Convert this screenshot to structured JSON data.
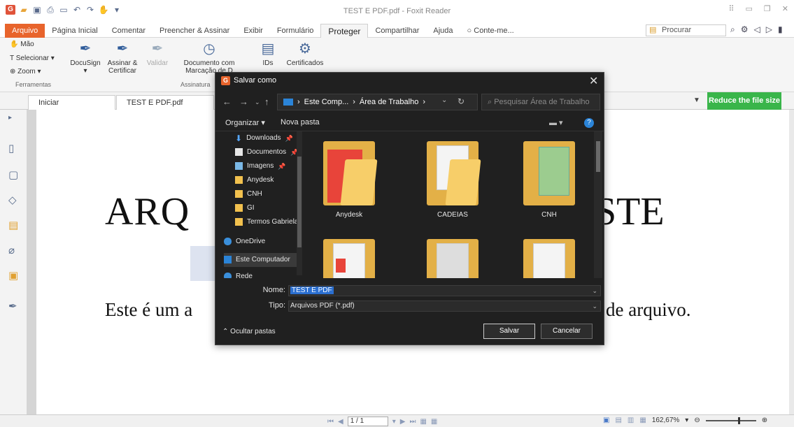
{
  "window": {
    "title": "TEST E PDF.pdf - Foxit Reader",
    "logo_letter": "G"
  },
  "menu": {
    "tabs": [
      "Arquivo",
      "Página Inicial",
      "Comentar",
      "Preencher & Assinar",
      "Exibir",
      "Formulário",
      "Proteger",
      "Compartilhar",
      "Ajuda",
      "Conte-me..."
    ],
    "active_tab": "Proteger",
    "search_placeholder": "Procurar"
  },
  "ribbon": {
    "tools": {
      "hand": "Mão",
      "select": "Selecionar",
      "zoom": "Zoom",
      "group_label": "Ferramentas"
    },
    "docusign": "DocuSign",
    "sign_certify_1": "Assinar &",
    "sign_certify_2": "Certificar",
    "validate": "Validar",
    "doc_with_1": "Documento com",
    "doc_with_2": "Marcação de D",
    "sign_group": "Assinatura",
    "ids": "IDs",
    "certificates": "Certificados"
  },
  "doctabs": {
    "start": "Iniciar",
    "file": "TEST E PDF.pdf",
    "reduce": "Reduce the file size"
  },
  "document": {
    "title_left": "ARQ",
    "title_right": "STE",
    "body_left": "Este é um a",
    "body_right": "de arquivo."
  },
  "statusbar": {
    "page": "1 / 1",
    "zoom": "162,67%"
  },
  "dialog": {
    "title": "Salvar como",
    "breadcrumb_1": "Este Comp...",
    "breadcrumb_2": "Área de Trabalho",
    "search_placeholder": "Pesquisar Área de Trabalho",
    "organize": "Organizar",
    "new_folder": "Nova pasta",
    "nav_items": [
      {
        "label": "Downloads",
        "icon": "download-icon",
        "pinned": true
      },
      {
        "label": "Documentos",
        "icon": "documents-icon",
        "pinned": true
      },
      {
        "label": "Imagens",
        "icon": "pictures-icon",
        "pinned": true
      },
      {
        "label": "Anydesk",
        "icon": "folder-icon",
        "pinned": false
      },
      {
        "label": "CNH",
        "icon": "folder-icon",
        "pinned": false
      },
      {
        "label": "GI",
        "icon": "folder-icon",
        "pinned": false
      },
      {
        "label": "Termos Gabriela",
        "icon": "folder-icon",
        "pinned": false
      },
      {
        "label": "OneDrive",
        "icon": "cloud-icon",
        "pinned": false
      },
      {
        "label": "Este Computador",
        "icon": "computer-icon",
        "pinned": false
      },
      {
        "label": "Rede",
        "icon": "network-icon",
        "pinned": false
      }
    ],
    "files": [
      {
        "name": "Anydesk",
        "style": "red"
      },
      {
        "name": "CADEIAS",
        "style": "paper"
      },
      {
        "name": "CNH",
        "style": "green"
      },
      {
        "name": "",
        "style": "red"
      },
      {
        "name": "",
        "style": "paper"
      },
      {
        "name": "",
        "style": "paper"
      }
    ],
    "name_label": "Nome:",
    "name_value": "TEST E PDF",
    "type_label": "Tipo:",
    "type_value": "Arquivos PDF (*.pdf)",
    "hide_folders": "Ocultar pastas",
    "save": "Salvar",
    "cancel": "Cancelar"
  },
  "colors": {
    "accent_orange": "#e8642c",
    "reduce_green": "#39b54a",
    "dialog_bg": "#202020",
    "selection_blue": "#2b6fd0"
  }
}
